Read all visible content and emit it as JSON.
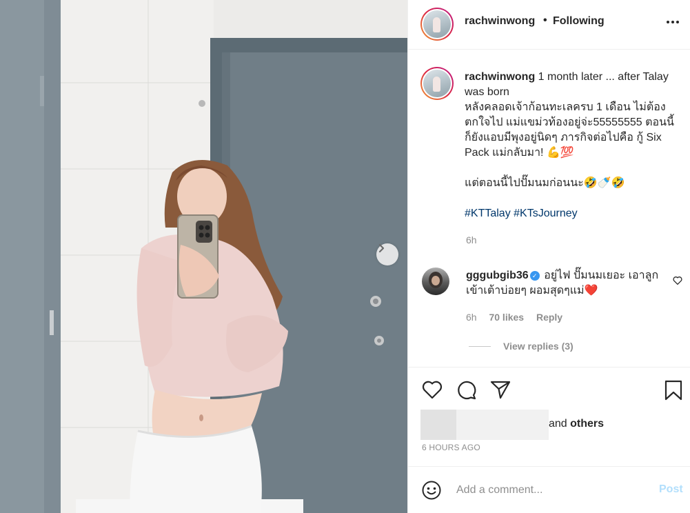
{
  "post": {
    "username": "rachwinwong",
    "dot": "•",
    "follow_status": "Following"
  },
  "caption": {
    "username": "rachwinwong",
    "text": " 1 month later ... after Talay was born\nหลังคลอดเจ้าก้อนทะเลครบ 1 เดือน ไม่ต้องตกใจไป แม่แขม่วท้องอยู่จ่ะ55555555 ตอนนี้ก็ยังแอบมีพุงอยู่นิดๆ ภารกิจต่อไปคือ กู้ Six Pack แม่กลับมา! 💪💯\n\nแต่ตอนนี้ไปปั๊มนมก่อนนะ🤣🍼🤣\n\n",
    "hashtag1": "#KTTalay",
    "hashtag2": "#KTsJourney",
    "time": "6h"
  },
  "comment": {
    "username": "gggubgib36",
    "verified_mark": "✓",
    "text": " อยู่ไฟ ปั๊มนมเยอะ เอาลูกเข้าเต้าบ่อยๆ ผอมสุดๆแม่❤️",
    "time": "6h",
    "likes": "70 likes",
    "reply": "Reply",
    "view_replies": "View replies (3)"
  },
  "likes_summary": {
    "and_text": "and ",
    "others_text": "others"
  },
  "timestamp": "6 HOURS AGO",
  "composer": {
    "placeholder": "Add a comment...",
    "post_label": "Post"
  },
  "icons": {
    "header_avatar": "avatar-story-ring",
    "more": "more-options-icon",
    "next": "chevron-right-icon",
    "like": "heart-outline-icon",
    "comment": "comment-bubble-icon",
    "share": "paper-plane-icon",
    "save": "bookmark-icon",
    "emoji": "smiley-icon"
  },
  "colors": {
    "link": "#00376b",
    "muted": "#8e8e8e",
    "post_disabled": "#b2dffc",
    "verified": "#3897f0",
    "story_ring_start": "#f09433",
    "story_ring_end": "#bc1888"
  }
}
